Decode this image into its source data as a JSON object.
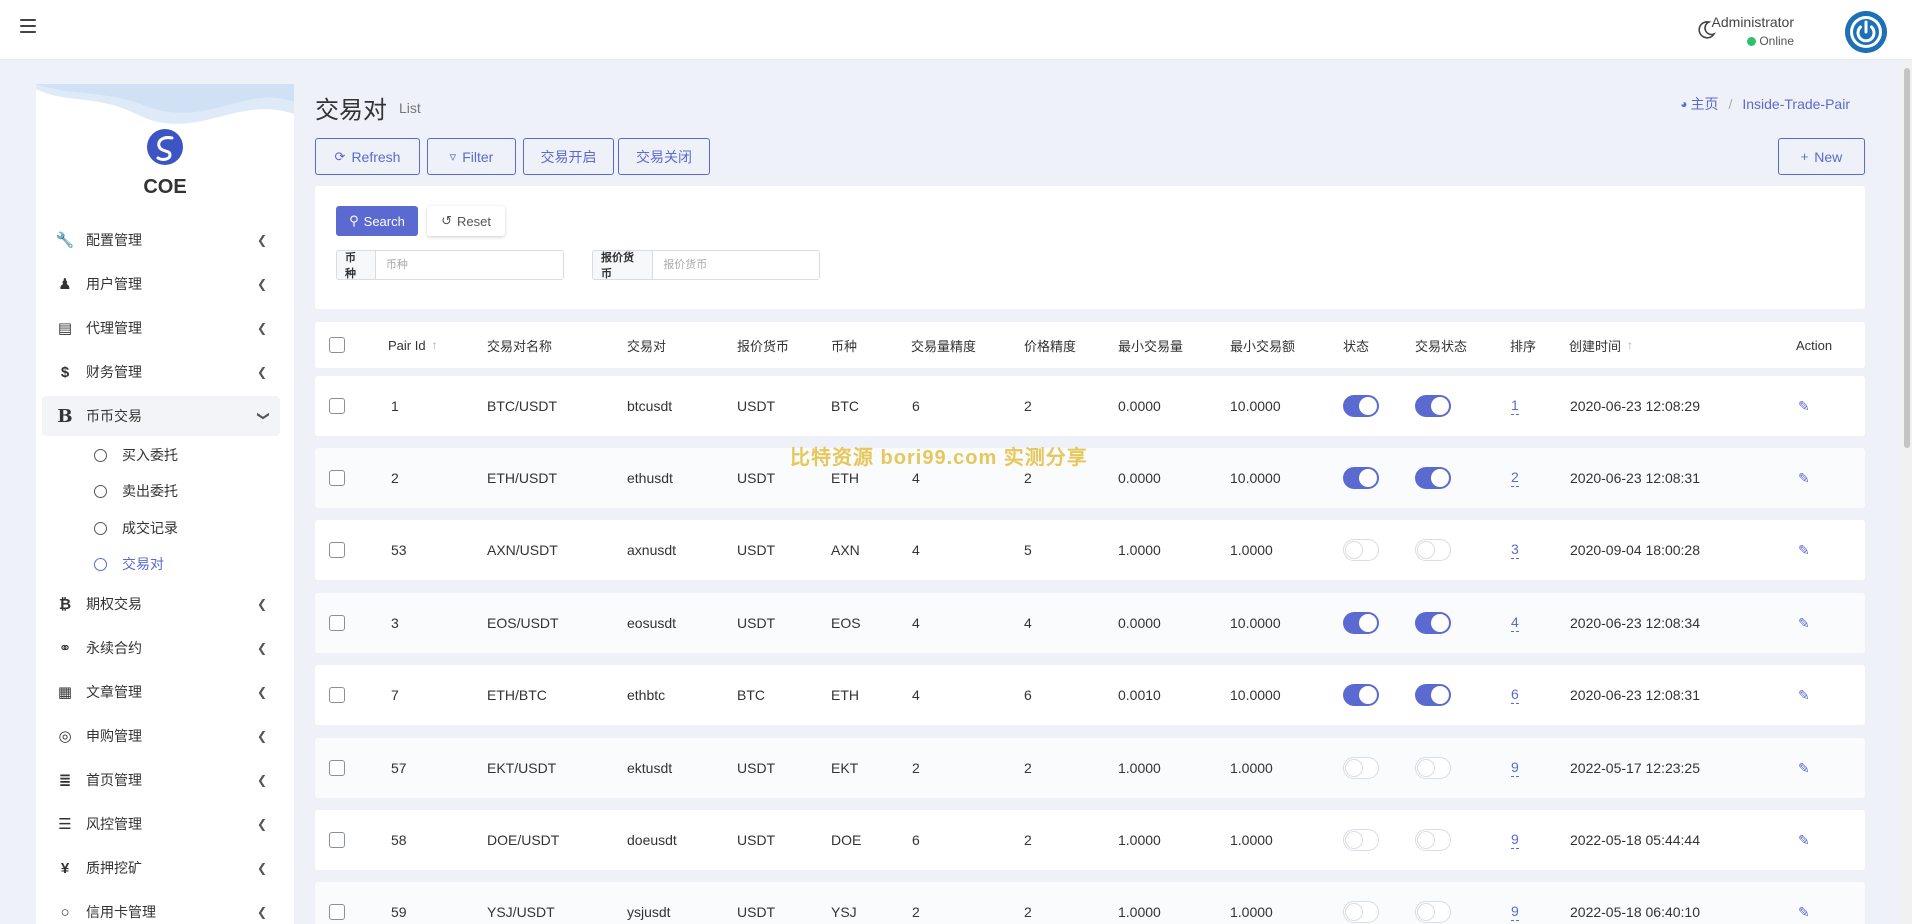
{
  "header": {
    "user_name": "Administrator",
    "user_status": "Online"
  },
  "sidebar": {
    "logo_text": "COE",
    "items": [
      {
        "label": "配置管理",
        "icon": "wrench-icon",
        "glyph": "🔧"
      },
      {
        "label": "用户管理",
        "icon": "users-icon",
        "glyph": "👥"
      },
      {
        "label": "代理管理",
        "icon": "id-card-icon",
        "glyph": "▤"
      },
      {
        "label": "财务管理",
        "icon": "dollar-icon",
        "glyph": "$"
      },
      {
        "label": "币币交易",
        "icon": "bitcoin-b-icon",
        "glyph": "B"
      },
      {
        "label": "期权交易",
        "icon": "bitcoin-icon",
        "glyph": "₿"
      },
      {
        "label": "永续合约",
        "icon": "link-icon",
        "glyph": "⚭"
      },
      {
        "label": "文章管理",
        "icon": "newspaper-icon",
        "glyph": "▦"
      },
      {
        "label": "申购管理",
        "icon": "lifebuoy-icon",
        "glyph": "◎"
      },
      {
        "label": "首页管理",
        "icon": "list-icon",
        "glyph": "≣"
      },
      {
        "label": "风控管理",
        "icon": "indent-icon",
        "glyph": "☰"
      },
      {
        "label": "质押挖矿",
        "icon": "yen-icon",
        "glyph": "¥"
      },
      {
        "label": "信用卡管理",
        "icon": "circle-icon",
        "glyph": "○"
      }
    ],
    "sub_items": [
      {
        "label": "买入委托"
      },
      {
        "label": "卖出委托"
      },
      {
        "label": "成交记录"
      },
      {
        "label": "交易对"
      }
    ]
  },
  "page": {
    "title": "交易对",
    "subtitle": "List",
    "breadcrumb_home": "主页",
    "breadcrumb_current": "Inside-Trade-Pair"
  },
  "toolbar": {
    "refresh": "Refresh",
    "filter": "Filter",
    "open_trade": "交易开启",
    "close_trade": "交易关闭",
    "new": "New"
  },
  "filter": {
    "search": "Search",
    "reset": "Reset",
    "coin_label": "币种",
    "coin_placeholder": "币种",
    "quote_label": "报价货币",
    "quote_placeholder": "报价货币"
  },
  "table": {
    "columns": [
      "Pair Id",
      "交易对名称",
      "交易对",
      "报价货币",
      "币种",
      "交易量精度",
      "价格精度",
      "最小交易量",
      "最小交易额",
      "状态",
      "交易状态",
      "排序",
      "创建时间",
      "Action"
    ],
    "rows": [
      {
        "id": "1",
        "name": "BTC/USDT",
        "pair": "btcusdt",
        "quote": "USDT",
        "coin": "BTC",
        "vol_prec": "6",
        "price_prec": "2",
        "min_vol": "0.0000",
        "min_amt": "10.0000",
        "status": true,
        "trade_status": true,
        "sort": "1",
        "created": "2020-06-23 12:08:29"
      },
      {
        "id": "2",
        "name": "ETH/USDT",
        "pair": "ethusdt",
        "quote": "USDT",
        "coin": "ETH",
        "vol_prec": "4",
        "price_prec": "2",
        "min_vol": "0.0000",
        "min_amt": "10.0000",
        "status": true,
        "trade_status": true,
        "sort": "2",
        "created": "2020-06-23 12:08:31"
      },
      {
        "id": "53",
        "name": "AXN/USDT",
        "pair": "axnusdt",
        "quote": "USDT",
        "coin": "AXN",
        "vol_prec": "4",
        "price_prec": "5",
        "min_vol": "1.0000",
        "min_amt": "1.0000",
        "status": false,
        "trade_status": false,
        "sort": "3",
        "created": "2020-09-04 18:00:28"
      },
      {
        "id": "3",
        "name": "EOS/USDT",
        "pair": "eosusdt",
        "quote": "USDT",
        "coin": "EOS",
        "vol_prec": "4",
        "price_prec": "4",
        "min_vol": "0.0000",
        "min_amt": "10.0000",
        "status": true,
        "trade_status": true,
        "sort": "4",
        "created": "2020-06-23 12:08:34"
      },
      {
        "id": "7",
        "name": "ETH/BTC",
        "pair": "ethbtc",
        "quote": "BTC",
        "coin": "ETH",
        "vol_prec": "4",
        "price_prec": "6",
        "min_vol": "0.0010",
        "min_amt": "10.0000",
        "status": true,
        "trade_status": true,
        "sort": "6",
        "created": "2020-06-23 12:08:31"
      },
      {
        "id": "57",
        "name": "EKT/USDT",
        "pair": "ektusdt",
        "quote": "USDT",
        "coin": "EKT",
        "vol_prec": "2",
        "price_prec": "2",
        "min_vol": "1.0000",
        "min_amt": "1.0000",
        "status": false,
        "trade_status": false,
        "sort": "9",
        "created": "2022-05-17 12:23:25"
      },
      {
        "id": "58",
        "name": "DOE/USDT",
        "pair": "doeusdt",
        "quote": "USDT",
        "coin": "DOE",
        "vol_prec": "6",
        "price_prec": "2",
        "min_vol": "1.0000",
        "min_amt": "1.0000",
        "status": false,
        "trade_status": false,
        "sort": "9",
        "created": "2022-05-18 05:44:44"
      },
      {
        "id": "59",
        "name": "YSJ/USDT",
        "pair": "ysjusdt",
        "quote": "USDT",
        "coin": "YSJ",
        "vol_prec": "2",
        "price_prec": "2",
        "min_vol": "1.0000",
        "min_amt": "1.0000",
        "status": false,
        "trade_status": false,
        "sort": "9",
        "created": "2022-05-18 06:40:10"
      }
    ]
  },
  "watermark": "比特资源 bori99.com 实测分享",
  "colors": {
    "accent": "#5b6ad0",
    "online": "#2fbf71",
    "background": "#eef1f7"
  }
}
